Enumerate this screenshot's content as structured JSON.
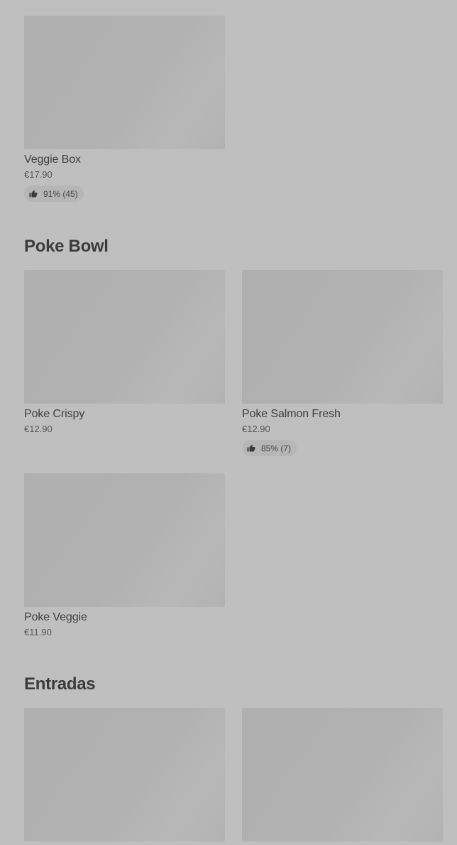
{
  "sections": [
    {
      "items": [
        {
          "name": "Veggie Box",
          "price": "€17.90",
          "rating": "91% (45)"
        }
      ]
    },
    {
      "title": "Poke Bowl",
      "items": [
        {
          "name": "Poke Crispy",
          "price": "€12.90"
        },
        {
          "name": "Poke Salmon Fresh",
          "price": "€12.90",
          "rating": "85% (7)"
        },
        {
          "name": "Poke Veggie",
          "price": "€11.90"
        }
      ]
    },
    {
      "title": "Entradas",
      "items": [
        {
          "name": "",
          "price": ""
        },
        {
          "name": "",
          "price": ""
        }
      ]
    }
  ],
  "icons": {
    "rating": "thumbs-up-icon"
  },
  "colors": {
    "background": "#bfbfbf",
    "image_placeholder": "#b1b1b1",
    "rating_pill": "#b6b6b6",
    "text": "#3a3a3a"
  }
}
